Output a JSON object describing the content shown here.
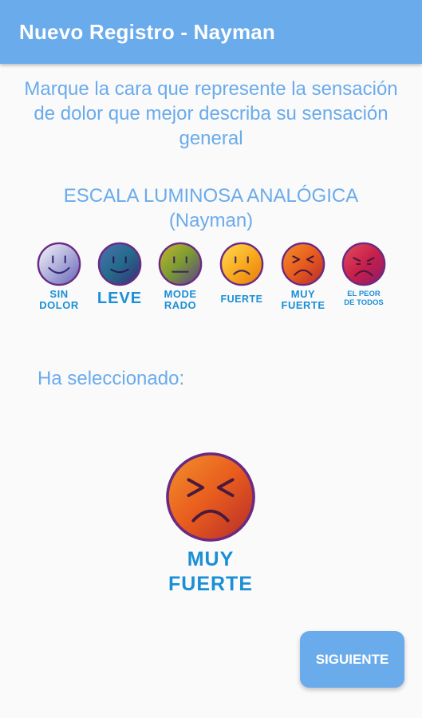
{
  "header": {
    "title": "Nuevo Registro - Nayman"
  },
  "instructions": "Marque la cara que represente la sensación de dolor que mejor describa su sensación general",
  "scale": {
    "title_line1": "ESCALA LUMINOSA ANALÓGICA",
    "title_line2": "(Nayman)"
  },
  "faces": [
    {
      "label": "SIN\nDOLOR",
      "icon": "smiling-face-icon",
      "colors": [
        "#f4f4fb",
        "#a9a9d8",
        "#6d6db8"
      ]
    },
    {
      "label": "LEVE",
      "icon": "slight-smile-face-icon",
      "colors": [
        "#4d6fb0",
        "#2a6a8f",
        "#3b2a7a"
      ]
    },
    {
      "label": "MODE\nRADO",
      "icon": "neutral-face-icon",
      "colors": [
        "#b0b52b",
        "#7a9a33",
        "#5a3b8f"
      ]
    },
    {
      "label": "FUERTE",
      "icon": "frowning-face-icon",
      "colors": [
        "#ffd24a",
        "#f7a21a",
        "#e07a10"
      ]
    },
    {
      "label": "MUY\nFUERTE",
      "icon": "squinting-pain-face-icon",
      "colors": [
        "#f08a2a",
        "#e85c1e",
        "#b8282a"
      ]
    },
    {
      "label": "EL PEOR\nDE TODOS",
      "icon": "worst-pain-face-icon",
      "colors": [
        "#e04a5a",
        "#c8204a",
        "#8a1a6a"
      ]
    }
  ],
  "selection": {
    "label": "Ha seleccionado:",
    "value": "MUY\nFUERTE",
    "icon": "squinting-pain-face-icon"
  },
  "actions": {
    "next_label": "SIGUIENTE"
  },
  "colors": {
    "accent": "#6aabeb",
    "label_blue": "#1a8fd6",
    "face_border": "#6a2a82"
  }
}
